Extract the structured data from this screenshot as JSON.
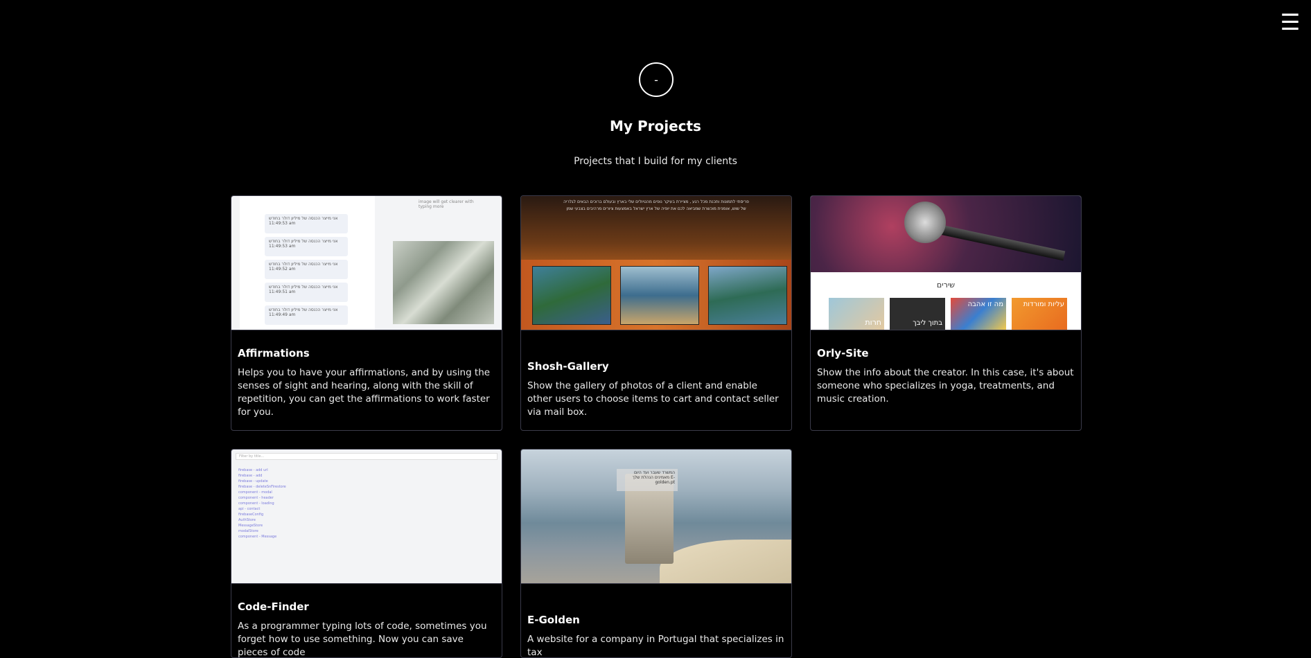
{
  "header": {
    "menu_icon": "☰",
    "avatar_text": "-"
  },
  "hero": {
    "title": "My Projects",
    "subtitle": "Projects that I build for my clients"
  },
  "projects": [
    {
      "title": "Affirmations",
      "description": "Helps you to have your affirmations, and by using the senses of sight and hearing, along with the skill of repetition, you can get the affirmations to work faster for you."
    },
    {
      "title": "Shosh-Gallery",
      "description": "Show the gallery of photos of a client and enable other users to choose items to cart and contact seller via mail box."
    },
    {
      "title": "Orly-Site",
      "description": "Show the info about the creator. In this case, it's about someone who specializes in yoga, treatments, and music creation."
    },
    {
      "title": "Code-Finder",
      "description": "As a programmer typing lots of code, sometimes you forget how to use something. Now you can save pieces of code"
    },
    {
      "title": "E-Golden",
      "description": "A website for a company in Portugal that specializes in tax"
    }
  ],
  "thumbs": {
    "affirmations": {
      "hint": "image will get clearer with typing more",
      "messages": [
        {
          "text": "אני מייצר הכנסה של מיליון דולר בחודש",
          "time": "11:49:53 am"
        },
        {
          "text": "אני מייצר הכנסה של מיליון דולר בחודש",
          "time": "11:49:53 am"
        },
        {
          "text": "אני מייצר הכנסה של מיליון דולר בחודש",
          "time": "11:49:52 am"
        },
        {
          "text": "אני מייצר הכנסה של מיליון דולר בחודש",
          "time": "11:49:51 am"
        },
        {
          "text": "אני מייצר הכנסה של מיליון דולר בחודש",
          "time": "11:49:49 am"
        }
      ]
    },
    "shosh": {
      "text": "פריסתי לתמונות ותכנת מכל רגע , מציירת בעיקר נופים מהטיולים שלי בארץ ובעולם ברוכים הבאים לגלריה של שוש, אומנית מוכשרת שמביאה לכם את יופיה של ארץ ישראל באמצעות ציורים מרהיבים בצבעי שמן"
    },
    "orly": {
      "songs_heading": "שירים",
      "tiles": [
        "חרות",
        "בתוך ליבך",
        "מה זו אהבה",
        "עליות ומורדות"
      ]
    },
    "code": {
      "filter_placeholder": "Filter by title...",
      "items": [
        "firebase - add url",
        "firebase - add",
        "firebase - update",
        "firebase - deleteSnFirestore",
        "component - modal",
        "component - header",
        "component - loading",
        "api - contact",
        "firebaseConfig",
        "AuthStore",
        "MessageStore",
        "modalStore",
        "component - Message"
      ]
    },
    "gold": {
      "overlay": "המשרד שעבר ועד היום מאמינים הנהלת שלך E-golden.pt"
    }
  }
}
